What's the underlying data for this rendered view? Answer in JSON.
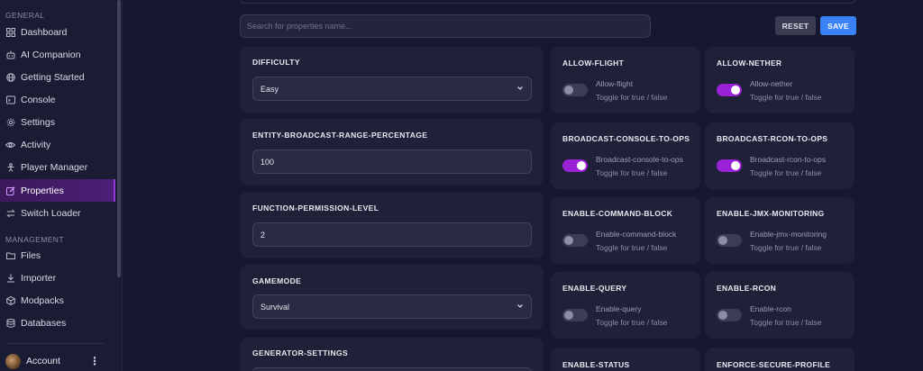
{
  "sidebar": {
    "general_label": "GENERAL",
    "management_label": "MANAGEMENT",
    "items": [
      {
        "label": "Dashboard",
        "icon": "grid-icon"
      },
      {
        "label": "AI Companion",
        "icon": "robot-icon"
      },
      {
        "label": "Getting Started",
        "icon": "globe-icon"
      },
      {
        "label": "Console",
        "icon": "terminal-icon"
      },
      {
        "label": "Settings",
        "icon": "gear-icon"
      },
      {
        "label": "Activity",
        "icon": "eye-icon"
      },
      {
        "label": "Player Manager",
        "icon": "person-icon"
      },
      {
        "label": "Properties",
        "icon": "edit-icon",
        "active": true
      },
      {
        "label": "Switch Loader",
        "icon": "swap-icon"
      }
    ],
    "management_items": [
      {
        "label": "Files",
        "icon": "folder-icon"
      },
      {
        "label": "Importer",
        "icon": "download-icon"
      },
      {
        "label": "Modpacks",
        "icon": "package-icon"
      },
      {
        "label": "Databases",
        "icon": "database-icon"
      }
    ],
    "account_label": "Account"
  },
  "toolbar": {
    "search_placeholder": "Search for properties name...",
    "reset_label": "RESET",
    "save_label": "SAVE"
  },
  "colors": {
    "accent": "#9a22d6",
    "save": "#3b82f6",
    "background": "#161830",
    "card": "#1f2139"
  },
  "fields": [
    {
      "name": "DIFFICULTY",
      "value": "Easy",
      "type": "select"
    },
    {
      "name": "ENTITY-BROADCAST-RANGE-PERCENTAGE",
      "value": "100",
      "type": "input"
    },
    {
      "name": "FUNCTION-PERMISSION-LEVEL",
      "value": "2",
      "type": "input"
    },
    {
      "name": "GAMEMODE",
      "value": "Survival",
      "type": "select"
    },
    {
      "name": "GENERATOR-SETTINGS"
    }
  ],
  "toggles": [
    {
      "title": "ALLOW-FLIGHT",
      "label": "Allow-flight",
      "hint": "Toggle for true / false",
      "on": false
    },
    {
      "title": "ALLOW-NETHER",
      "label": "Allow-nether",
      "hint": "Toggle for true / false",
      "on": true
    },
    {
      "title": "BROADCAST-CONSOLE-TO-OPS",
      "label": "Broadcast-console-to-ops",
      "hint": "Toggle for true / false",
      "on": true
    },
    {
      "title": "BROADCAST-RCON-TO-OPS",
      "label": "Broadcast-rcon-to-ops",
      "hint": "Toggle for true / false",
      "on": true
    },
    {
      "title": "ENABLE-COMMAND-BLOCK",
      "label": "Enable-command-block",
      "hint": "Toggle for true / false",
      "on": false
    },
    {
      "title": "ENABLE-JMX-MONITORING",
      "label": "Enable-jmx-monitoring",
      "hint": "Toggle for true / false",
      "on": false
    },
    {
      "title": "ENABLE-QUERY",
      "label": "Enable-query",
      "hint": "Toggle for true / false",
      "on": false
    },
    {
      "title": "ENABLE-RCON",
      "label": "Enable-rcon",
      "hint": "Toggle for true / false",
      "on": false
    },
    {
      "title": "ENABLE-STATUS"
    },
    {
      "title": "ENFORCE-SECURE-PROFILE"
    }
  ]
}
